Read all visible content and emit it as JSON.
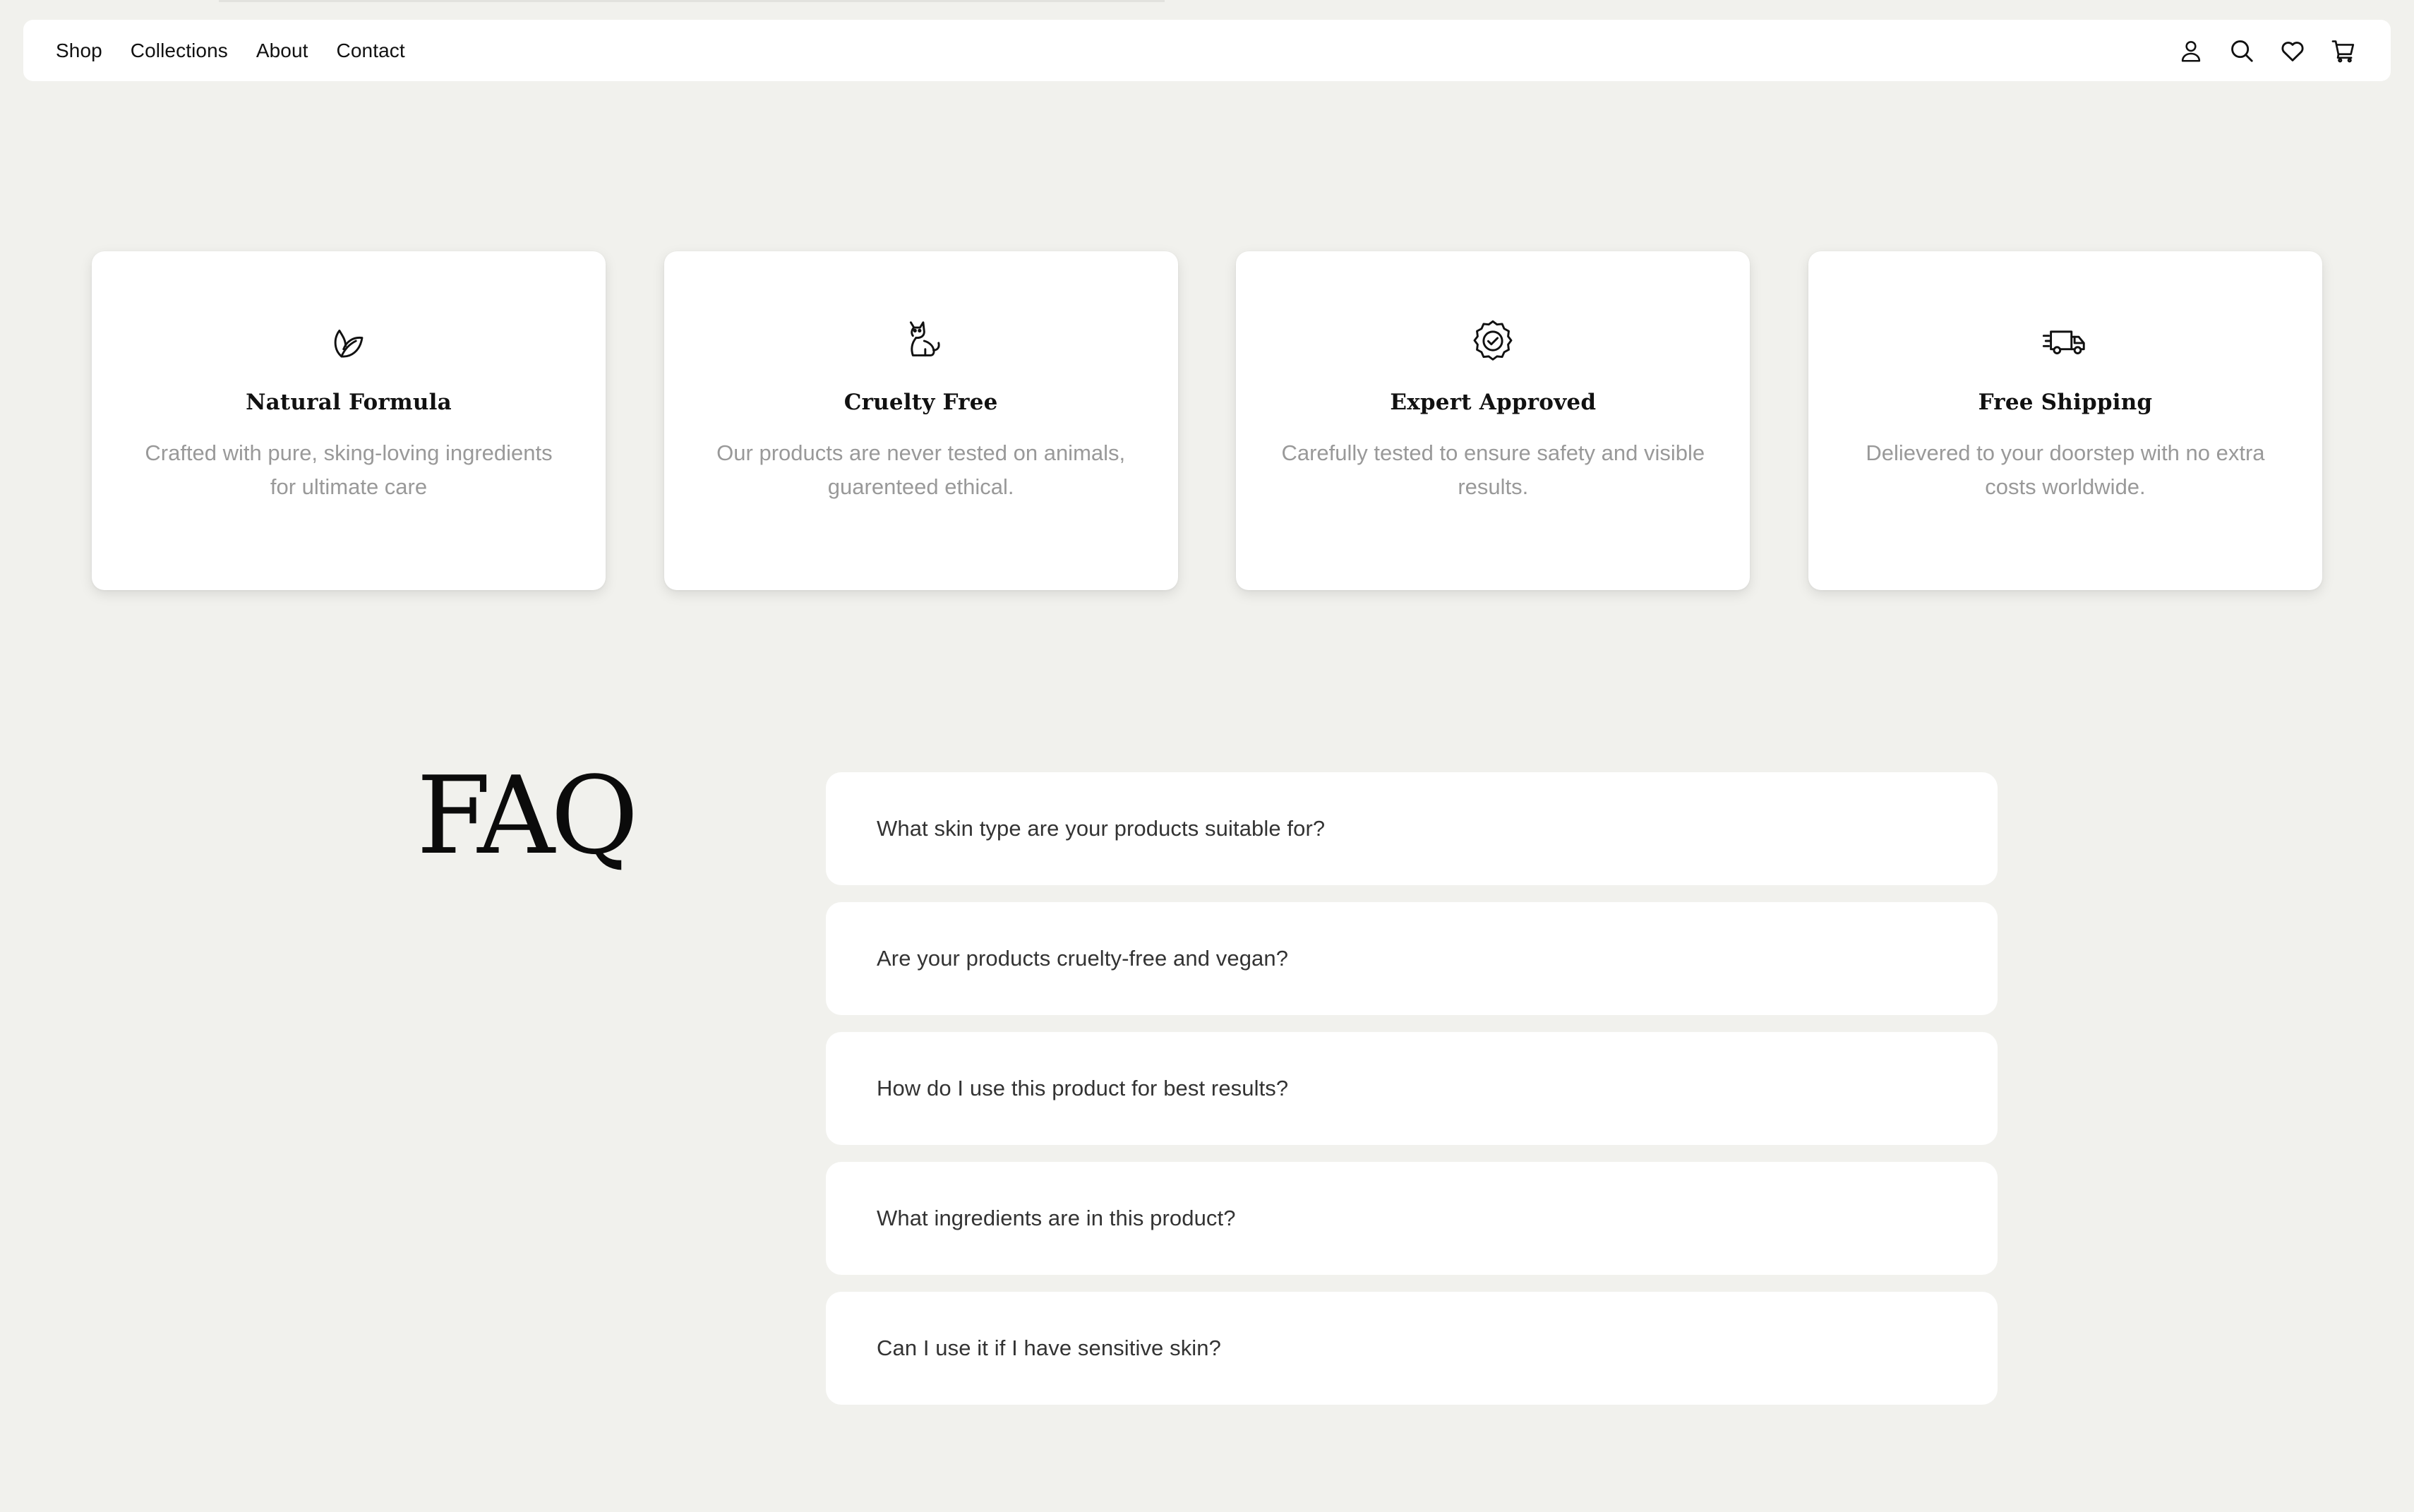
{
  "nav": {
    "links": [
      {
        "label": "Shop"
      },
      {
        "label": "Collections"
      },
      {
        "label": "About"
      },
      {
        "label": "Contact"
      }
    ],
    "icons": [
      "user-icon",
      "search-icon",
      "heart-icon",
      "cart-icon"
    ]
  },
  "features": [
    {
      "icon": "leaf-icon",
      "title": "Natural Formula",
      "description": "Crafted with pure, sking-loving ingredients for ultimate care"
    },
    {
      "icon": "cat-icon",
      "title": "Cruelty Free",
      "description": "Our products are never tested on animals, guarenteed ethical."
    },
    {
      "icon": "verified-badge-icon",
      "title": "Expert Approved",
      "description": "Carefully tested to ensure safety and visible results."
    },
    {
      "icon": "truck-icon",
      "title": "Free Shipping",
      "description": "Delievered to your doorstep with no extra costs worldwide."
    }
  ],
  "faq": {
    "heading": "FAQ",
    "questions": [
      "What skin type are your products suitable for?",
      "Are your products cruelty-free and vegan?",
      "How do I use this product for best results?",
      "What ingredients are in this product?",
      "Can I use it if I have sensitive skin?"
    ]
  },
  "colors": {
    "background": "#f1f1ed",
    "surface": "#ffffff",
    "muted_text": "#999999"
  }
}
